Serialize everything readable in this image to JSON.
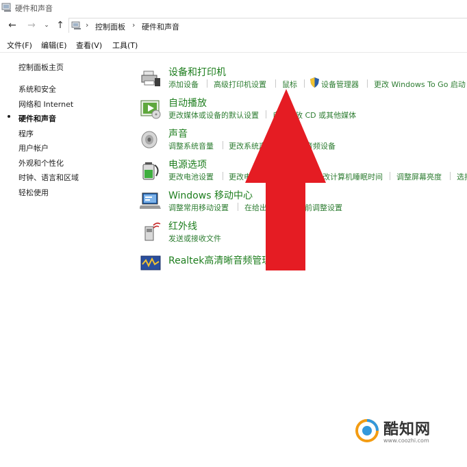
{
  "window": {
    "title": "硬件和声音"
  },
  "address": {
    "crumbs": [
      "控制面板",
      "硬件和声音"
    ]
  },
  "menu": [
    "文件(F)",
    "编辑(E)",
    "查看(V)",
    "工具(T)"
  ],
  "sidebar": {
    "home": "控制面板主页",
    "items": [
      "系统和安全",
      "网络和 Internet",
      "硬件和声音",
      "程序",
      "用户帐户",
      "外观和个性化",
      "时钟、语言和区域",
      "轻松使用"
    ],
    "active_index": 2
  },
  "categories": [
    {
      "title": "设备和打印机",
      "links": [
        "添加设备",
        "高级打印机设置",
        "鼠标",
        "设备管理器",
        "更改 Windows To Go 启动"
      ]
    },
    {
      "title": "自动播放",
      "links": [
        "更改媒体或设备的默认设置",
        "自动播放 CD 或其他媒体"
      ]
    },
    {
      "title": "声音",
      "links": [
        "调整系统音量",
        "更改系统声音",
        "管理音频设备"
      ]
    },
    {
      "title": "电源选项",
      "links": [
        "更改电池设置",
        "更改电源按钮的功能",
        "更改计算机睡眠时间",
        "调整屏幕亮度",
        "选择"
      ]
    },
    {
      "title": "Windows 移动中心",
      "links": [
        "调整常用移动设置",
        "在给出演示文稿之前调整设置"
      ]
    },
    {
      "title": "红外线",
      "links": [
        "发送或接收文件"
      ]
    },
    {
      "title": "Realtek高清晰音频管理器",
      "links": []
    }
  ],
  "watermark": {
    "name": "酷知网",
    "url": "www.coozhi.com"
  },
  "colors": {
    "link_green": "#2e7d32",
    "arrow_red": "#e51c23"
  }
}
